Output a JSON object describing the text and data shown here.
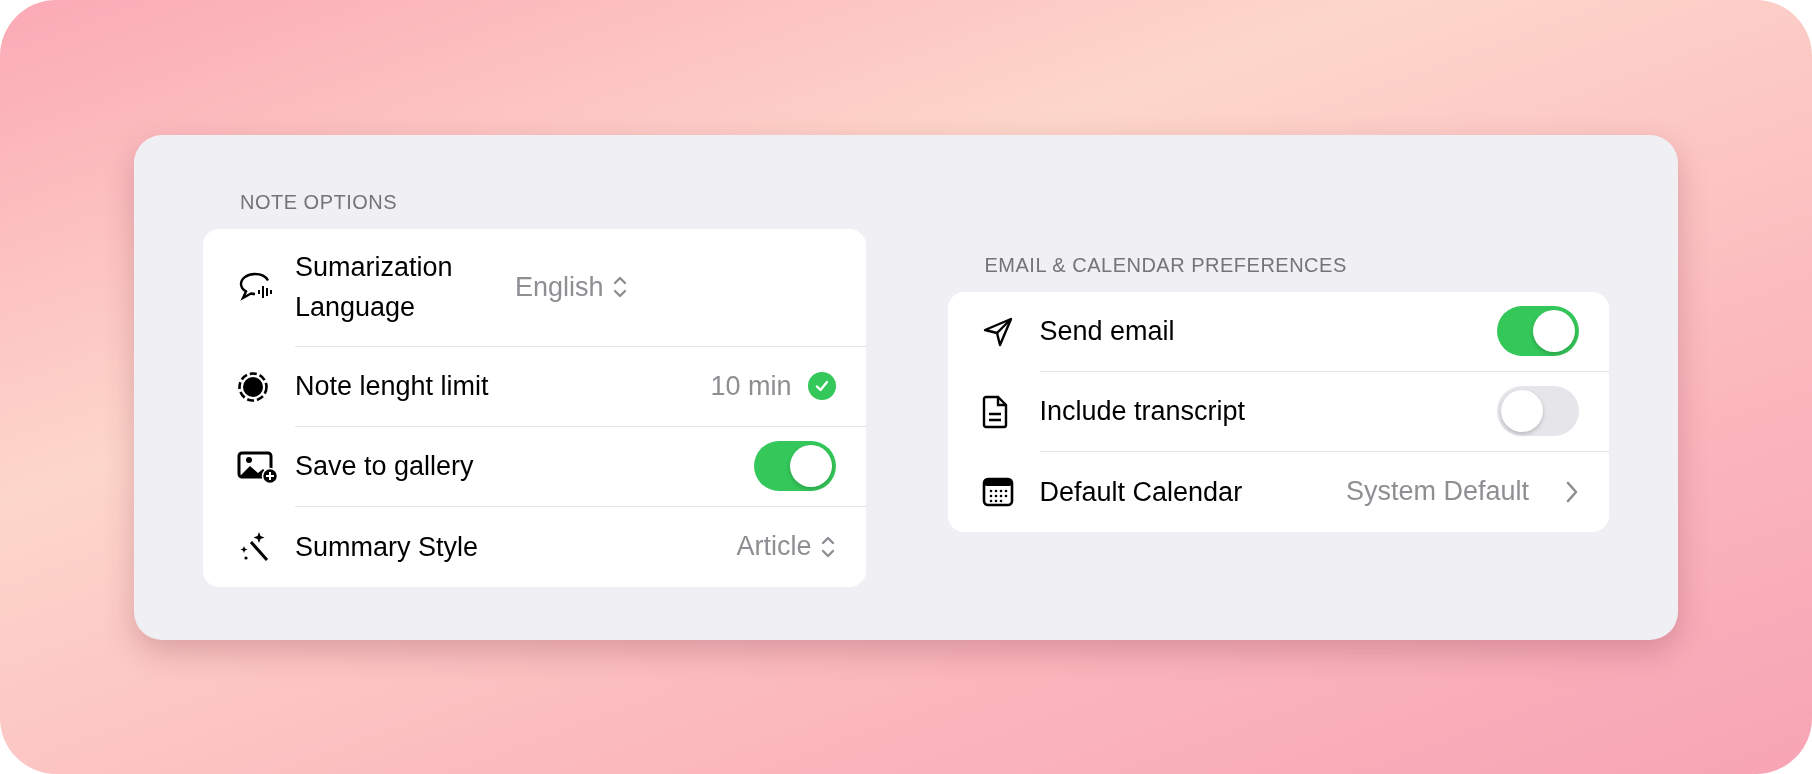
{
  "sections": [
    {
      "header": "NOTE OPTIONS",
      "rows": [
        {
          "kind": "select",
          "label": "Sumarization Language",
          "value": "English"
        },
        {
          "kind": "check",
          "label": "Note lenght limit",
          "value": "10 min",
          "checked": true
        },
        {
          "kind": "toggle",
          "label": "Save to gallery",
          "on": true
        },
        {
          "kind": "select",
          "label": "Summary Style",
          "value": "Article"
        }
      ]
    },
    {
      "header": "EMAIL & CALENDAR PREFERENCES",
      "rows": [
        {
          "kind": "toggle",
          "label": "Send email",
          "on": true
        },
        {
          "kind": "toggle",
          "label": "Include transcript",
          "on": false
        },
        {
          "kind": "link",
          "label": "Default Calendar",
          "value": "System Default"
        }
      ]
    }
  ]
}
